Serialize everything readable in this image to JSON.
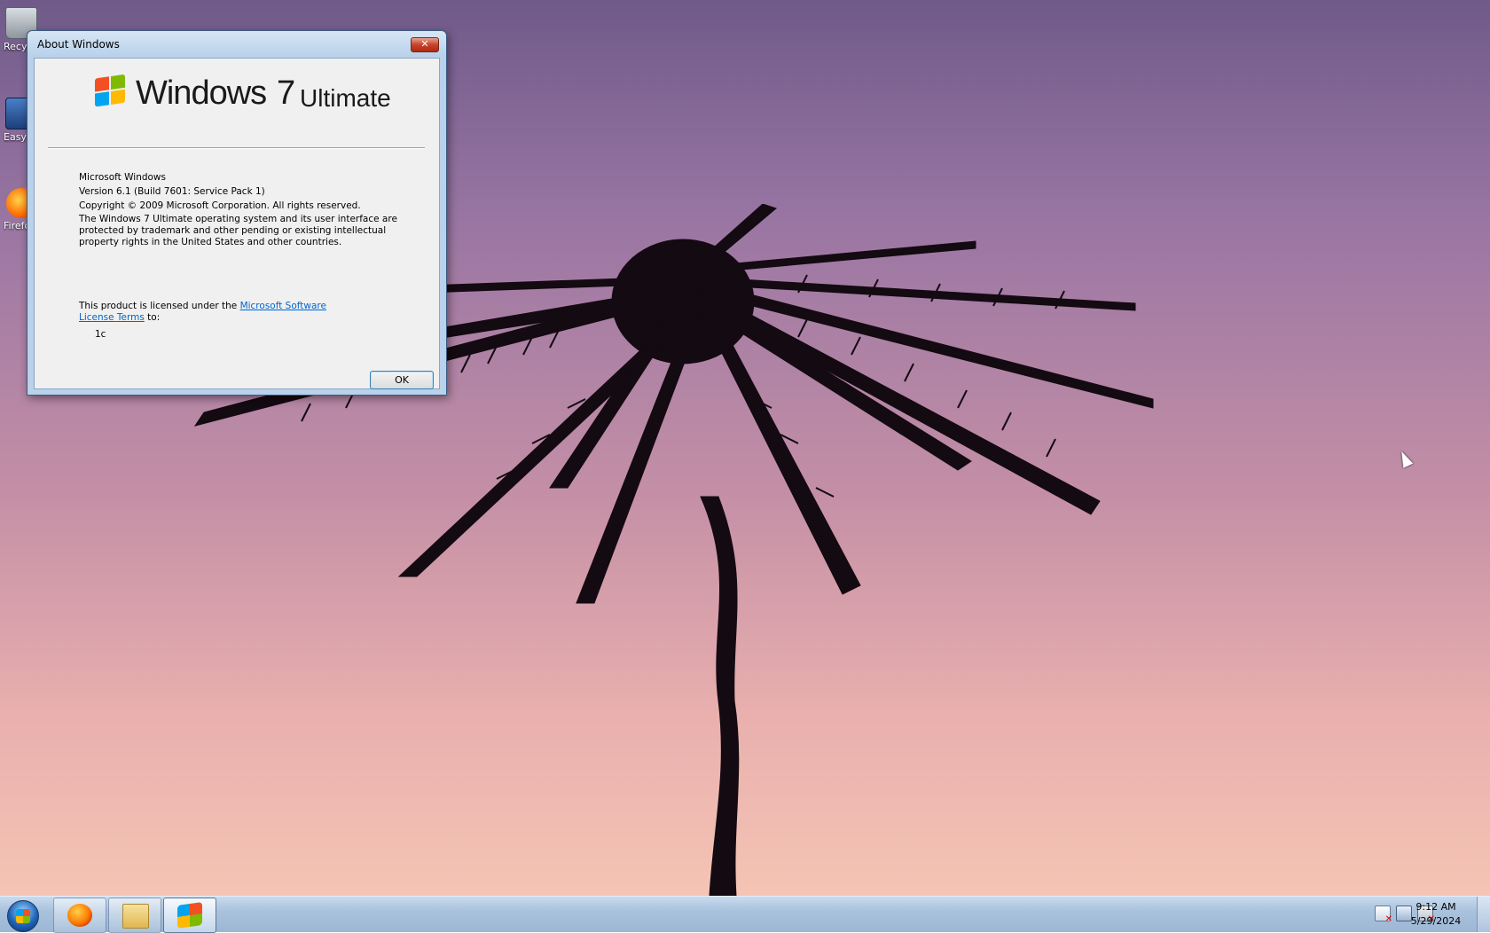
{
  "desktop": {
    "icons": [
      {
        "label": "Recycle Bin"
      },
      {
        "label": "Easy"
      },
      {
        "label": "Firefox"
      }
    ]
  },
  "dialog": {
    "title": "About Windows",
    "close_label": "✕",
    "brand": {
      "name": "Windows",
      "version": "7",
      "edition": "Ultimate"
    },
    "product": "Microsoft Windows",
    "version": "Version 6.1 (Build 7601: Service Pack 1)",
    "copyright": "Copyright © 2009 Microsoft Corporation.  All rights reserved.",
    "legal": "The Windows 7 Ultimate operating system and its user interface are protected by trademark and other pending or existing intellectual property rights in the United States and other countries.",
    "license_prefix": "This product is licensed under the ",
    "license_link": "Microsoft Software License Terms",
    "license_suffix": " to:",
    "licensee": "1c",
    "ok_label": "OK"
  },
  "taskbar": {
    "items": [
      {
        "name": "Firefox"
      },
      {
        "name": "Windows Explorer"
      },
      {
        "name": "About Windows"
      }
    ],
    "clock": {
      "time": "9:12 AM",
      "date": "5/29/2024"
    }
  }
}
